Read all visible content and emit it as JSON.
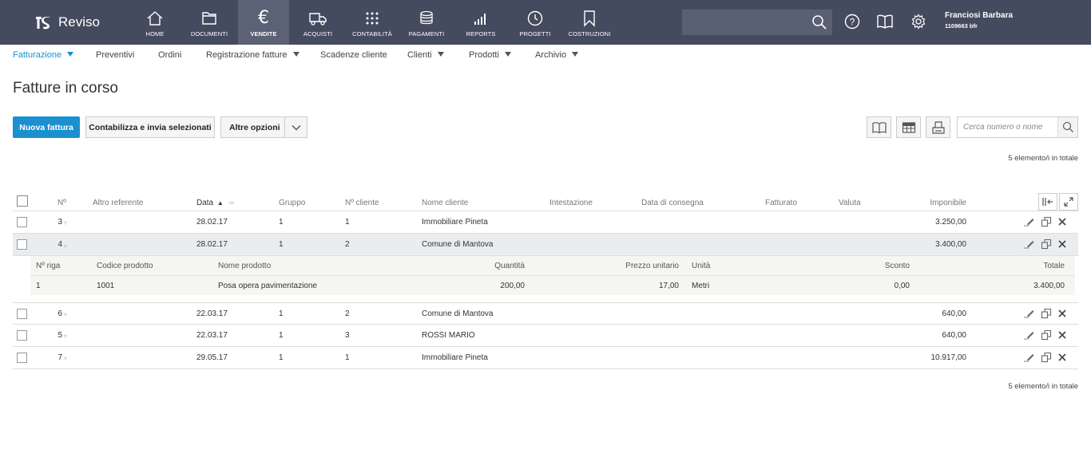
{
  "app": {
    "name": "Reviso"
  },
  "topnav": [
    {
      "label": "HOME",
      "icon": "home-icon"
    },
    {
      "label": "DOCUMENTI",
      "icon": "folder-icon"
    },
    {
      "label": "VENDITE",
      "icon": "euro-icon",
      "active": true
    },
    {
      "label": "ACQUISTI",
      "icon": "truck-icon"
    },
    {
      "label": "CONTABILITÀ",
      "icon": "grid-icon"
    },
    {
      "label": "PAGAMENTI",
      "icon": "coins-icon"
    },
    {
      "label": "REPORTS",
      "icon": "bar-chart-icon"
    },
    {
      "label": "PROGETTI",
      "icon": "clock-icon"
    },
    {
      "label": "COSTRUZIONI",
      "icon": "bookmark-icon"
    }
  ],
  "user": {
    "name": "Franciosi Barbara",
    "code": "1109663 bfr"
  },
  "subnav": [
    {
      "label": "Fatturazione",
      "caret": true,
      "active": true
    },
    {
      "label": "Preventivi",
      "caret": false
    },
    {
      "label": "Ordini",
      "caret": false
    },
    {
      "label": "Registrazione fatture",
      "caret": true
    },
    {
      "label": "Scadenze cliente",
      "caret": false
    },
    {
      "label": "Clienti",
      "caret": true
    },
    {
      "label": "Prodotti",
      "caret": true
    },
    {
      "label": "Archivio",
      "caret": true
    }
  ],
  "page": {
    "title": "Fatture in corso",
    "new_invoice": "Nuova fattura",
    "post_selected": "Contabilizza e invia selezionati",
    "more_options": "Altre opzioni",
    "search_placeholder": "Cerca numero o nome",
    "count_text": "5 elemento/i in totale"
  },
  "table": {
    "columns": [
      "Nº",
      "Altro referente",
      "Data",
      "Gruppo",
      "Nº cliente",
      "Nome cliente",
      "Intestazione",
      "Data di consegna",
      "Fatturato",
      "Valuta",
      "Imponibile"
    ],
    "rows": [
      {
        "n": "3",
        "date": "28.02.17",
        "group": "1",
        "client_no": "1",
        "client": "Immobiliare Pineta",
        "amount": "3.250,00"
      },
      {
        "n": "4",
        "date": "28.02.17",
        "group": "1",
        "client_no": "2",
        "client": "Comune di Mantova",
        "amount": "3.400,00",
        "expanded": true
      },
      {
        "n": "6",
        "date": "22.03.17",
        "group": "1",
        "client_no": "2",
        "client": "Comune di Mantova",
        "amount": "640,00"
      },
      {
        "n": "5",
        "date": "22.03.17",
        "group": "1",
        "client_no": "3",
        "client": "ROSSI MARIO",
        "amount": "640,00"
      },
      {
        "n": "7",
        "date": "29.05.17",
        "group": "1",
        "client_no": "1",
        "client": "Immobiliare Pineta",
        "amount": "10.917,00"
      }
    ],
    "detail": {
      "columns": [
        "Nº riga",
        "Codice prodotto",
        "Nome prodotto",
        "Quantità",
        "Prezzo unitario",
        "Unità",
        "Sconto",
        "Totale"
      ],
      "row": {
        "line": "1",
        "code": "1001",
        "name": "Posa opera pavimentazione",
        "qty": "200,00",
        "price": "17,00",
        "unit": "Metri",
        "discount": "0,00",
        "total": "3.400,00"
      }
    }
  },
  "colors": {
    "topbar": "#454b5e",
    "accent": "#1a90d0"
  }
}
